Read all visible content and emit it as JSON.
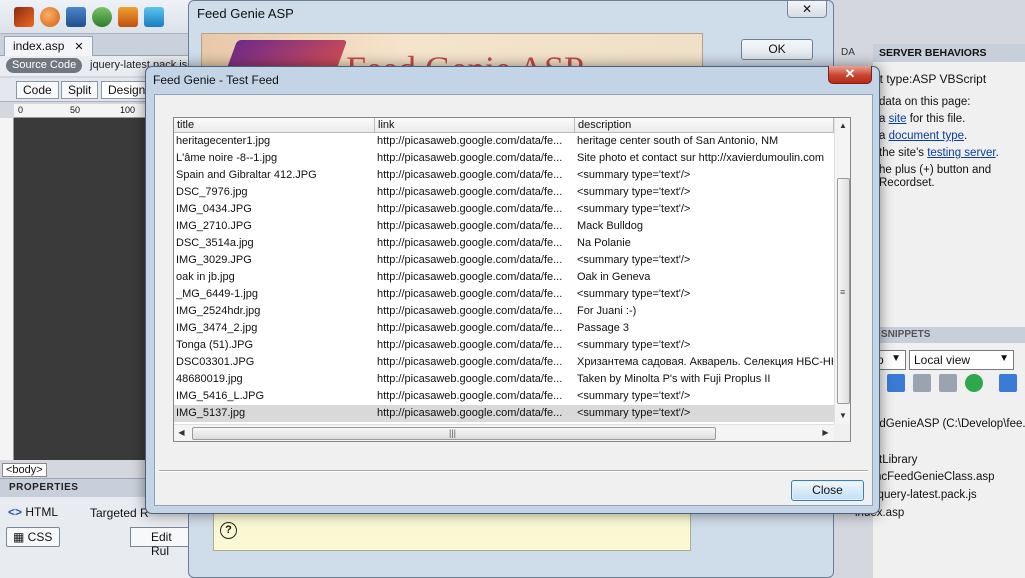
{
  "ide": {
    "doc_tab": "index.asp",
    "doc_tab_close": "✕",
    "source_code_label": "Source Code",
    "related_file": "jquery-latest.pack.js",
    "views": {
      "code": "Code",
      "split": "Split",
      "design": "Design"
    },
    "ruler_ticks": [
      "0",
      "50",
      "100"
    ],
    "body_tag": "<body>",
    "properties": {
      "title": "PROPERTIES",
      "html_label": "HTML",
      "css_label": "CSS",
      "targeted_label": "Targeted R",
      "edit_rule_label": "Edit Rul"
    },
    "right_panel": {
      "da_tab": "DA",
      "server_behaviors_tab": "SERVER BEHAVIORS",
      "document_type": "nt type:ASP VBScript",
      "line1": "data on this page:",
      "line2_prefix": "a ",
      "line2_link": "site",
      "line2_suffix": " for this file.",
      "line3_prefix": "a ",
      "line3_link": "document type",
      "line3_suffix": ".",
      "line4_prefix": "the site's ",
      "line4_link": "testing server",
      "line4_suffix": ".",
      "line5": "he plus (+) button and",
      "line6": "Recordset.",
      "snippets_tab": "SNIPPETS",
      "site_select": "p",
      "view_select": "Local view",
      "tree": [
        "edGenieASP (C:\\Develop\\fee...",
        "tLibrary",
        "ncFeedGenieClass.asp",
        "jquery-latest.pack.js",
        "index.asp"
      ]
    }
  },
  "asp_dialog": {
    "title": "Feed Genie ASP",
    "close_symbol": "✕",
    "banner_text": "Feed Genie ASP",
    "ok_label": "OK",
    "help_symbol": "?"
  },
  "test_feed": {
    "title": "Feed Genie - Test Feed",
    "close_symbol": "✕",
    "columns": {
      "title": "title",
      "link": "link",
      "description": "description"
    },
    "rows": [
      {
        "title": "heritagecenter1.jpg",
        "link": "http://picasaweb.google.com/data/fe...",
        "description": "heritage center south of San Antonio, NM"
      },
      {
        "title": "L'âme noire -8--1.jpg",
        "link": "http://picasaweb.google.com/data/fe...",
        "description": "Site photo et contact sur http://xavierdumoulin.com"
      },
      {
        "title": "Spain and Gibraltar 412.JPG",
        "link": "http://picasaweb.google.com/data/fe...",
        "description": "<summary type='text'/>"
      },
      {
        "title": "DSC_7976.jpg",
        "link": "http://picasaweb.google.com/data/fe...",
        "description": "<summary type='text'/>"
      },
      {
        "title": "IMG_0434.JPG",
        "link": "http://picasaweb.google.com/data/fe...",
        "description": "<summary type='text'/>"
      },
      {
        "title": "IMG_2710.JPG",
        "link": "http://picasaweb.google.com/data/fe...",
        "description": "Mack Bulldog"
      },
      {
        "title": "DSC_3514a.jpg",
        "link": "http://picasaweb.google.com/data/fe...",
        "description": "Na Polanie"
      },
      {
        "title": "IMG_3029.JPG",
        "link": "http://picasaweb.google.com/data/fe...",
        "description": "<summary type='text'/>"
      },
      {
        "title": "oak in jb.jpg",
        "link": "http://picasaweb.google.com/data/fe...",
        "description": "Oak in Geneva"
      },
      {
        "title": "_MG_6449-1.jpg",
        "link": "http://picasaweb.google.com/data/fe...",
        "description": "<summary type='text'/>"
      },
      {
        "title": "IMG_2524hdr.jpg",
        "link": "http://picasaweb.google.com/data/fe...",
        "description": "For Juani :-)"
      },
      {
        "title": "IMG_3474_2.jpg",
        "link": "http://picasaweb.google.com/data/fe...",
        "description": "Passage 3"
      },
      {
        "title": "Tonga (51).JPG",
        "link": "http://picasaweb.google.com/data/fe...",
        "description": "<summary type='text'/>"
      },
      {
        "title": "DSC03301.JPG",
        "link": "http://picasaweb.google.com/data/fe...",
        "description": "Хризантема садовая. Акварель. Селекция НБС-НН"
      },
      {
        "title": "48680019.jpg",
        "link": "http://picasaweb.google.com/data/fe...",
        "description": "Taken by Minolta P's with Fuji Proplus II"
      },
      {
        "title": "IMG_5416_L.JPG",
        "link": "http://picasaweb.google.com/data/fe...",
        "description": "<summary type='text'/>"
      },
      {
        "title": "IMG_5137.jpg",
        "link": "http://picasaweb.google.com/data/fe...",
        "description": "<summary type='text'/>"
      }
    ],
    "selected_row_index": 16,
    "close_button": "Close"
  }
}
